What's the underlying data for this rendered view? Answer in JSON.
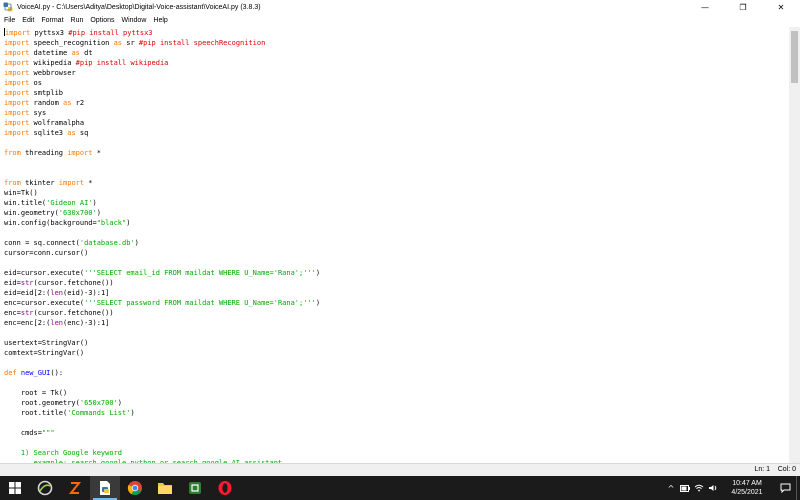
{
  "window": {
    "title": "VoiceAI.py - C:\\Users\\Aditya\\Desktop\\Digital-Voice-assistant\\VoiceAI.py (3.8.3)",
    "controls": {
      "minimize": "—",
      "maximize": "❐",
      "close": "✕"
    }
  },
  "menu": [
    "File",
    "Edit",
    "Format",
    "Run",
    "Options",
    "Window",
    "Help"
  ],
  "code_lines": [
    [
      {
        "t": "kw",
        "v": "import"
      },
      {
        "t": "",
        "v": " pyttsx3 "
      },
      {
        "t": "cmt",
        "v": "#pip install pyttsx3"
      }
    ],
    [
      {
        "t": "kw",
        "v": "import"
      },
      {
        "t": "",
        "v": " speech_recognition "
      },
      {
        "t": "kw",
        "v": "as"
      },
      {
        "t": "",
        "v": " sr "
      },
      {
        "t": "cmt",
        "v": "#pip install speechRecognition"
      }
    ],
    [
      {
        "t": "kw",
        "v": "import"
      },
      {
        "t": "",
        "v": " datetime "
      },
      {
        "t": "kw",
        "v": "as"
      },
      {
        "t": "",
        "v": " dt"
      }
    ],
    [
      {
        "t": "kw",
        "v": "import"
      },
      {
        "t": "",
        "v": " wikipedia "
      },
      {
        "t": "cmt",
        "v": "#pip install wikipedia"
      }
    ],
    [
      {
        "t": "kw",
        "v": "import"
      },
      {
        "t": "",
        "v": " webbrowser"
      }
    ],
    [
      {
        "t": "kw",
        "v": "import"
      },
      {
        "t": "",
        "v": " os"
      }
    ],
    [
      {
        "t": "kw",
        "v": "import"
      },
      {
        "t": "",
        "v": " smtplib"
      }
    ],
    [
      {
        "t": "kw",
        "v": "import"
      },
      {
        "t": "",
        "v": " random "
      },
      {
        "t": "kw",
        "v": "as"
      },
      {
        "t": "",
        "v": " r2"
      }
    ],
    [
      {
        "t": "kw",
        "v": "import"
      },
      {
        "t": "",
        "v": " sys"
      }
    ],
    [
      {
        "t": "kw",
        "v": "import"
      },
      {
        "t": "",
        "v": " wolframalpha"
      }
    ],
    [
      {
        "t": "kw",
        "v": "import"
      },
      {
        "t": "",
        "v": " sqlite3 "
      },
      {
        "t": "kw",
        "v": "as"
      },
      {
        "t": "",
        "v": " sq"
      }
    ],
    [],
    [
      {
        "t": "kw",
        "v": "from"
      },
      {
        "t": "",
        "v": " threading "
      },
      {
        "t": "kw",
        "v": "import"
      },
      {
        "t": "",
        "v": " *"
      }
    ],
    [],
    [],
    [
      {
        "t": "kw",
        "v": "from"
      },
      {
        "t": "",
        "v": " tkinter "
      },
      {
        "t": "kw",
        "v": "import"
      },
      {
        "t": "",
        "v": " *"
      }
    ],
    [
      {
        "t": "",
        "v": "win=Tk()"
      }
    ],
    [
      {
        "t": "",
        "v": "win.title("
      },
      {
        "t": "str",
        "v": "'Gideon AI'"
      },
      {
        "t": "",
        "v": ")"
      }
    ],
    [
      {
        "t": "",
        "v": "win.geometry("
      },
      {
        "t": "str",
        "v": "'630x700'"
      },
      {
        "t": "",
        "v": ")"
      }
    ],
    [
      {
        "t": "",
        "v": "win.config(background="
      },
      {
        "t": "str",
        "v": "\"black\""
      },
      {
        "t": "",
        "v": ")"
      }
    ],
    [],
    [
      {
        "t": "",
        "v": "conn = sq.connect("
      },
      {
        "t": "str",
        "v": "'database.db'"
      },
      {
        "t": "",
        "v": ")"
      }
    ],
    [
      {
        "t": "",
        "v": "cursor=conn.cursor()"
      }
    ],
    [],
    [
      {
        "t": "",
        "v": "eid=cursor.execute("
      },
      {
        "t": "str",
        "v": "'''SELECT email_id FROM maildat WHERE U_Name='Rana';'''"
      },
      {
        "t": "",
        "v": ")"
      }
    ],
    [
      {
        "t": "",
        "v": "eid="
      },
      {
        "t": "bi",
        "v": "str"
      },
      {
        "t": "",
        "v": "(cursor.fetchone())"
      }
    ],
    [
      {
        "t": "",
        "v": "eid=eid[2:("
      },
      {
        "t": "bi",
        "v": "len"
      },
      {
        "t": "",
        "v": "(eid)-3):1]"
      }
    ],
    [
      {
        "t": "",
        "v": "enc=cursor.execute("
      },
      {
        "t": "str",
        "v": "'''SELECT password FROM maildat WHERE U_Name='Rana';'''"
      },
      {
        "t": "",
        "v": ")"
      }
    ],
    [
      {
        "t": "",
        "v": "enc="
      },
      {
        "t": "bi",
        "v": "str"
      },
      {
        "t": "",
        "v": "(cursor.fetchone())"
      }
    ],
    [
      {
        "t": "",
        "v": "enc=enc[2:("
      },
      {
        "t": "bi",
        "v": "len"
      },
      {
        "t": "",
        "v": "(enc)-3):1]"
      }
    ],
    [],
    [
      {
        "t": "",
        "v": "usertext=StringVar()"
      }
    ],
    [
      {
        "t": "",
        "v": "comtext=StringVar()"
      }
    ],
    [],
    [
      {
        "t": "kw",
        "v": "def"
      },
      {
        "t": "",
        "v": " "
      },
      {
        "t": "def",
        "v": "new_GUI"
      },
      {
        "t": "",
        "v": "():"
      }
    ],
    [],
    [
      {
        "t": "",
        "v": "    root = Tk()"
      }
    ],
    [
      {
        "t": "",
        "v": "    root.geometry("
      },
      {
        "t": "str",
        "v": "'650x700'"
      },
      {
        "t": "",
        "v": ")"
      }
    ],
    [
      {
        "t": "",
        "v": "    root.title("
      },
      {
        "t": "str",
        "v": "'Commands List'"
      },
      {
        "t": "",
        "v": ")"
      }
    ],
    [],
    [
      {
        "t": "",
        "v": "    cmds="
      },
      {
        "t": "str",
        "v": "\"\"\""
      }
    ],
    [],
    [
      {
        "t": "str",
        "v": "    1) Search Google keyword"
      }
    ],
    [
      {
        "t": "str",
        "v": "       example: search google python or search google AI assistant"
      }
    ]
  ],
  "status": {
    "line": "Ln: 1",
    "col": "Col: 0"
  },
  "taskbar": {
    "clock_time": "10:47 AM",
    "clock_date": "4/25/2021",
    "icons": [
      "windows-logo",
      "search",
      "task-view",
      "app-orange",
      "idle-python",
      "chrome",
      "file-explorer",
      "app-green",
      "opera"
    ]
  },
  "colors": {
    "keyword": "#ff7700",
    "string": "#00aa00",
    "comment": "#dd0000",
    "builtin": "#900090",
    "defname": "#0000ff",
    "taskbar": "#1b1b1b"
  }
}
